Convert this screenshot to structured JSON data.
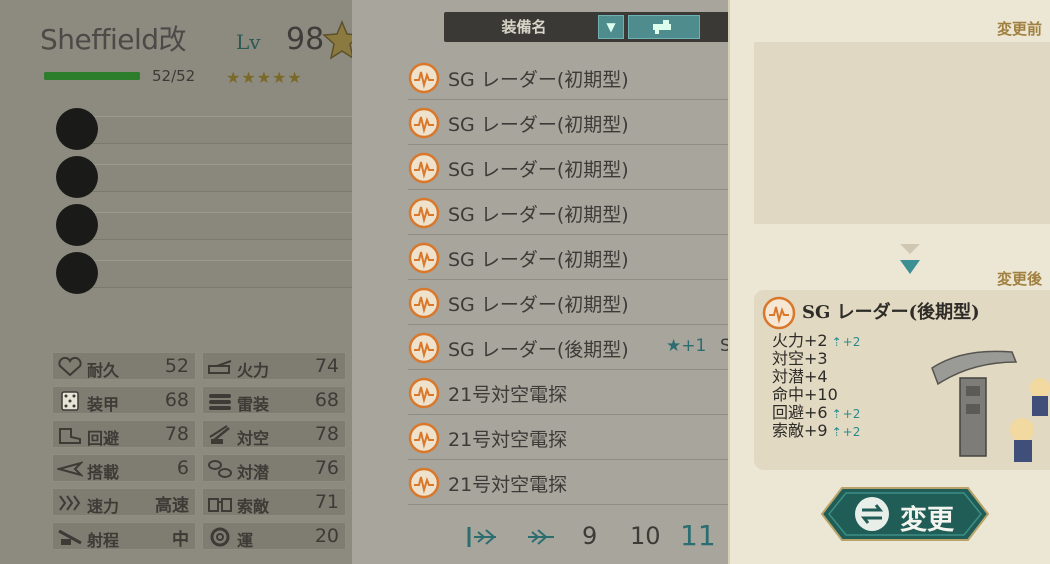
{
  "ship": {
    "name": "Sheffield改",
    "level_label": "Lv",
    "level": "98",
    "hp_text": "52/52",
    "hp_fraction": 1.0,
    "stars": "★★★★★",
    "slots": 4
  },
  "stats": [
    {
      "icon": "heart-icon",
      "label": "耐久",
      "value": "52"
    },
    {
      "icon": "cannon-icon",
      "label": "火力",
      "value": "74"
    },
    {
      "icon": "dice-icon",
      "label": "装甲",
      "value": "68"
    },
    {
      "icon": "torpedo-icon",
      "label": "雷装",
      "value": "68"
    },
    {
      "icon": "boot-icon",
      "label": "回避",
      "value": "78"
    },
    {
      "icon": "aa-gun-icon",
      "label": "対空",
      "value": "78"
    },
    {
      "icon": "plane-icon",
      "label": "搭載",
      "value": "6"
    },
    {
      "icon": "depth-charge-icon",
      "label": "対潜",
      "value": "76"
    },
    {
      "icon": "speed-icon",
      "label": "速力",
      "value": "高速"
    },
    {
      "icon": "binoculars-icon",
      "label": "索敵",
      "value": "71"
    },
    {
      "icon": "range-icon",
      "label": "射程",
      "value": "中"
    },
    {
      "icon": "lifebuoy-icon",
      "label": "運",
      "value": "20"
    }
  ],
  "list": {
    "header": "装備名",
    "sort_glyph": "▼",
    "rows": [
      {
        "name": "SG レーダー(初期型)",
        "stars": "",
        "extra": ""
      },
      {
        "name": "SG レーダー(初期型)",
        "stars": "",
        "extra": ""
      },
      {
        "name": "SG レーダー(初期型)",
        "stars": "",
        "extra": ""
      },
      {
        "name": "SG レーダー(初期型)",
        "stars": "",
        "extra": ""
      },
      {
        "name": "SG レーダー(初期型)",
        "stars": "",
        "extra": ""
      },
      {
        "name": "SG レーダー(初期型)",
        "stars": "",
        "extra": ""
      },
      {
        "name": "SG レーダー(後期型)",
        "stars": "★+1",
        "extra": "S"
      },
      {
        "name": "21号対空電探",
        "stars": "",
        "extra": ""
      },
      {
        "name": "21号対空電探",
        "stars": "",
        "extra": ""
      },
      {
        "name": "21号対空電探",
        "stars": "",
        "extra": ""
      }
    ],
    "pages": [
      "9",
      "10",
      "11"
    ],
    "current_page": "11"
  },
  "change": {
    "before_label": "変更前",
    "after_label": "変更後",
    "item_name": "SG レーダー(後期型)",
    "stats": [
      {
        "text": "火力+2",
        "plus": "+2"
      },
      {
        "text": "対空+3",
        "plus": ""
      },
      {
        "text": "対潜+4",
        "plus": ""
      },
      {
        "text": "命中+10",
        "plus": ""
      },
      {
        "text": "回避+6",
        "plus": "+2"
      },
      {
        "text": "索敵+9",
        "plus": "+2"
      }
    ],
    "button_label": "変更"
  },
  "colors": {
    "accent_teal": "#2c8a8e",
    "radar_orange": "#d9772a",
    "gold": "#a08040"
  }
}
